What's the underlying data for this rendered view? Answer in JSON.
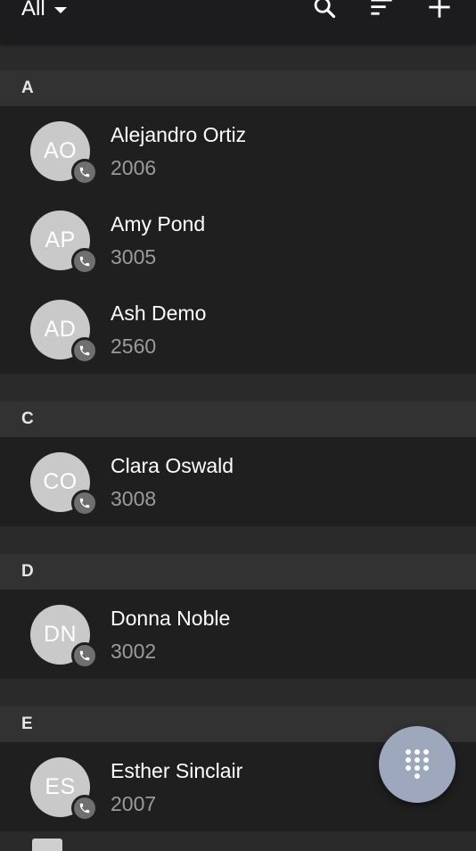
{
  "toolbar": {
    "filter_label": "All",
    "icons": [
      "search-icon",
      "sort-icon",
      "add-icon"
    ]
  },
  "sections": [
    {
      "letter": "A",
      "contacts": [
        {
          "initials": "AO",
          "name": "Alejandro Ortiz",
          "extension": "2006"
        },
        {
          "initials": "AP",
          "name": "Amy Pond",
          "extension": "3005"
        },
        {
          "initials": "AD",
          "name": "Ash Demo",
          "extension": "2560"
        }
      ]
    },
    {
      "letter": "C",
      "contacts": [
        {
          "initials": "CO",
          "name": "Clara Oswald",
          "extension": "3008"
        }
      ]
    },
    {
      "letter": "D",
      "contacts": [
        {
          "initials": "DN",
          "name": "Donna Noble",
          "extension": "3002"
        }
      ]
    },
    {
      "letter": "E",
      "contacts": [
        {
          "initials": "ES",
          "name": "Esther Sinclair",
          "extension": "2007"
        }
      ]
    }
  ],
  "fab": {
    "icon": "dialpad-icon"
  },
  "colors": {
    "background": "#2a2a2a",
    "row_background": "#1f1f1f",
    "section_header": "#323232",
    "avatar": "#c9c9c9",
    "fab": "#9ea8bc"
  }
}
